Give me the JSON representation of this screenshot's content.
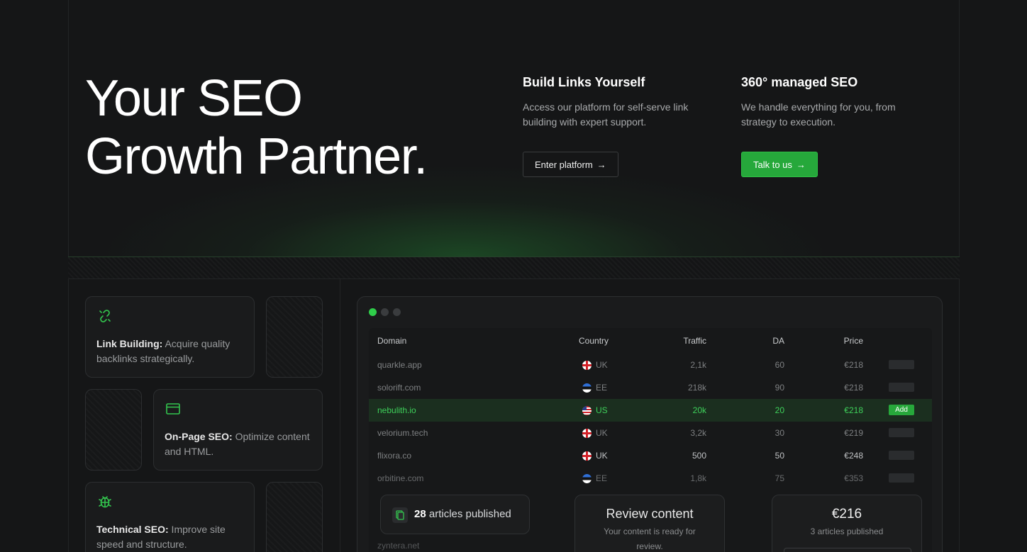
{
  "hero": {
    "title_line1": "Your SEO",
    "title_line2": "Growth Partner."
  },
  "offers": [
    {
      "title": "Build Links Yourself",
      "desc": "Access our platform for self-serve link building with expert support.",
      "button": "Enter platform"
    },
    {
      "title": "360° managed SEO",
      "desc": "We handle everything for you, from strategy to execution.",
      "button": "Talk to us"
    }
  ],
  "arrow_glyph": "→",
  "services": [
    {
      "name": "Link Building:",
      "desc": " Acquire quality backlinks strategically.",
      "icon": "link-icon"
    },
    {
      "name": "On-Page SEO:",
      "desc": " Optimize content and HTML.",
      "icon": "browser-window-icon"
    },
    {
      "name": "Technical SEO:",
      "desc": " Improve site speed and structure.",
      "icon": "bug-icon"
    }
  ],
  "table": {
    "headers": {
      "domain": "Domain",
      "country": "Country",
      "traffic": "Traffic",
      "da": "DA",
      "price": "Price"
    },
    "rows": [
      {
        "domain": "quarkle.app",
        "country": "UK",
        "traffic": "2,1k",
        "da": "60",
        "price": "€218",
        "action": ""
      },
      {
        "domain": "solorift.com",
        "country": "EE",
        "traffic": "218k",
        "da": "90",
        "price": "€218",
        "action": ""
      },
      {
        "domain": "nebulith.io",
        "country": "US",
        "traffic": "20k",
        "da": "20",
        "price": "€218",
        "action": "Add"
      },
      {
        "domain": "velorium.tech",
        "country": "UK",
        "traffic": "3,2k",
        "da": "30",
        "price": "€219",
        "action": ""
      },
      {
        "domain": "flixora.co",
        "country": "UK",
        "traffic": "500",
        "da": "50",
        "price": "€248",
        "action": ""
      },
      {
        "domain": "orbitine.com",
        "country": "EE",
        "traffic": "1,8k",
        "da": "75",
        "price": "€353",
        "action": ""
      }
    ],
    "faded_rows": [
      "zyntera.net"
    ]
  },
  "floats": {
    "articles_count": "28",
    "articles_label": " articles published",
    "review_title": "Review content",
    "review_desc": "Your content is ready for review.",
    "price_value": "€216",
    "price_desc": "3 articles published"
  },
  "colors": {
    "accent": "#26a83b",
    "background": "#151617",
    "highlight_text": "#3ed05a"
  }
}
